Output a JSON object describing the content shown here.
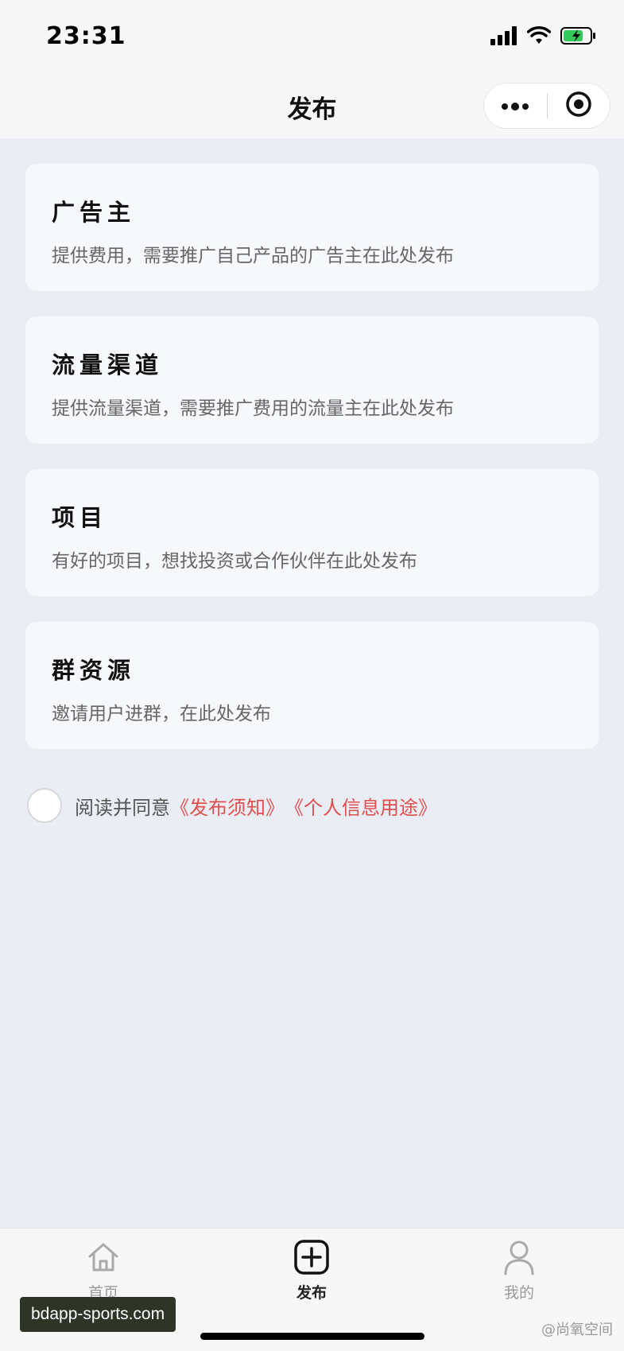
{
  "status_bar": {
    "time": "23:31"
  },
  "nav": {
    "title": "发布"
  },
  "cards": [
    {
      "title": "广告主",
      "desc": "提供费用，需要推广自己产品的广告主在此处发布"
    },
    {
      "title": "流量渠道",
      "desc": "提供流量渠道，需要推广费用的流量主在此处发布"
    },
    {
      "title": "项目",
      "desc": "有好的项目，想找投资或合作伙伴在此处发布"
    },
    {
      "title": "群资源",
      "desc": "邀请用户进群，在此处发布"
    }
  ],
  "agreement": {
    "prefix": "阅读并同意",
    "link_notice": "《发布须知》",
    "link_privacy": "《个人信息用途》"
  },
  "tabbar": {
    "items": [
      {
        "label": "首页",
        "icon": "home-icon"
      },
      {
        "label": "发布",
        "icon": "plus-square-icon"
      },
      {
        "label": "我的",
        "icon": "person-icon"
      }
    ]
  },
  "watermarks": {
    "left": "bdapp-sports.com",
    "right": "@尚氧空间"
  },
  "colors": {
    "link": "#e05050",
    "background": "#eaeef4",
    "card": "#f6f8fb"
  }
}
